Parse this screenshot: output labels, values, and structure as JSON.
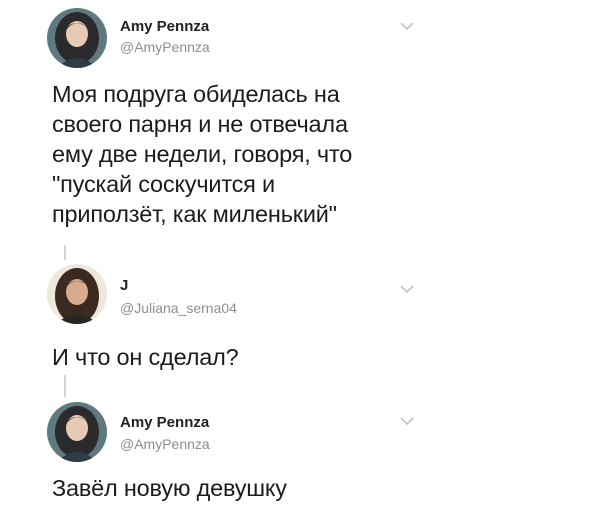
{
  "tweets": [
    {
      "author_name": "Amy Pennza",
      "handle": "@AmyPennza",
      "avatar_icon": "woman-portrait-avatar",
      "text": "Моя подруга обиделась на\nсвоего парня и не отвечала\nему две недели, говоря, что\n\"пускай соскучится и\nприползёт, как миленький\""
    },
    {
      "author_name": "J",
      "handle": "@Juliana_serna04",
      "avatar_icon": "woman-portrait-avatar",
      "text": "И что он сделал?"
    },
    {
      "author_name": "Amy Pennza",
      "handle": "@AmyPennza",
      "avatar_icon": "woman-portrait-avatar",
      "text": "Завёл новую девушку"
    }
  ],
  "chevron_icon": "chevron-down-icon",
  "colors": {
    "text": "#1c1c1c",
    "handle": "#8a8f94",
    "thread_line": "#d0d4d8"
  }
}
